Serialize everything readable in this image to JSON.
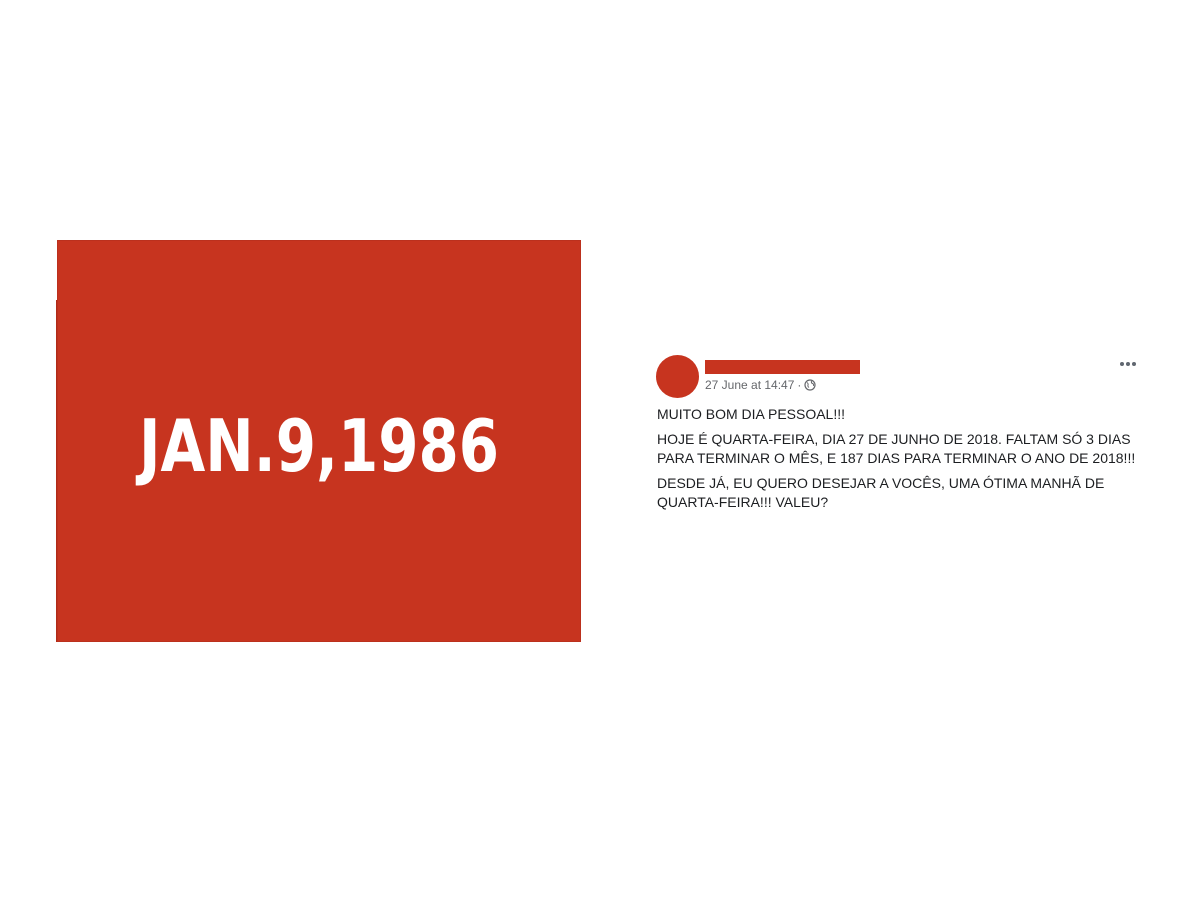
{
  "image": {
    "date_text": "JAN.9,1986",
    "background_color": "#c7341f",
    "text_color": "#ffffff"
  },
  "post": {
    "author_redacted_color": "#c7341f",
    "avatar_color": "#c7341f",
    "timestamp": "27 June at 14:47",
    "separator": "·",
    "privacy_icon": "globe-icon",
    "menu_icon": "more-options-icon",
    "paragraphs": [
      "MUITO BOM DIA PESSOAL!!!",
      "HOJE É QUARTA-FEIRA, DIA 27 DE JUNHO DE 2018. FALTAM SÓ 3 DIAS PARA TERMINAR O MÊS, E 187 DIAS PARA TERMINAR O ANO DE 2018!!!",
      "DESDE JÁ, EU QUERO DESEJAR A VOCÊS, UMA ÓTIMA MANHÃ DE QUARTA-FEIRA!!! VALEU?"
    ]
  }
}
